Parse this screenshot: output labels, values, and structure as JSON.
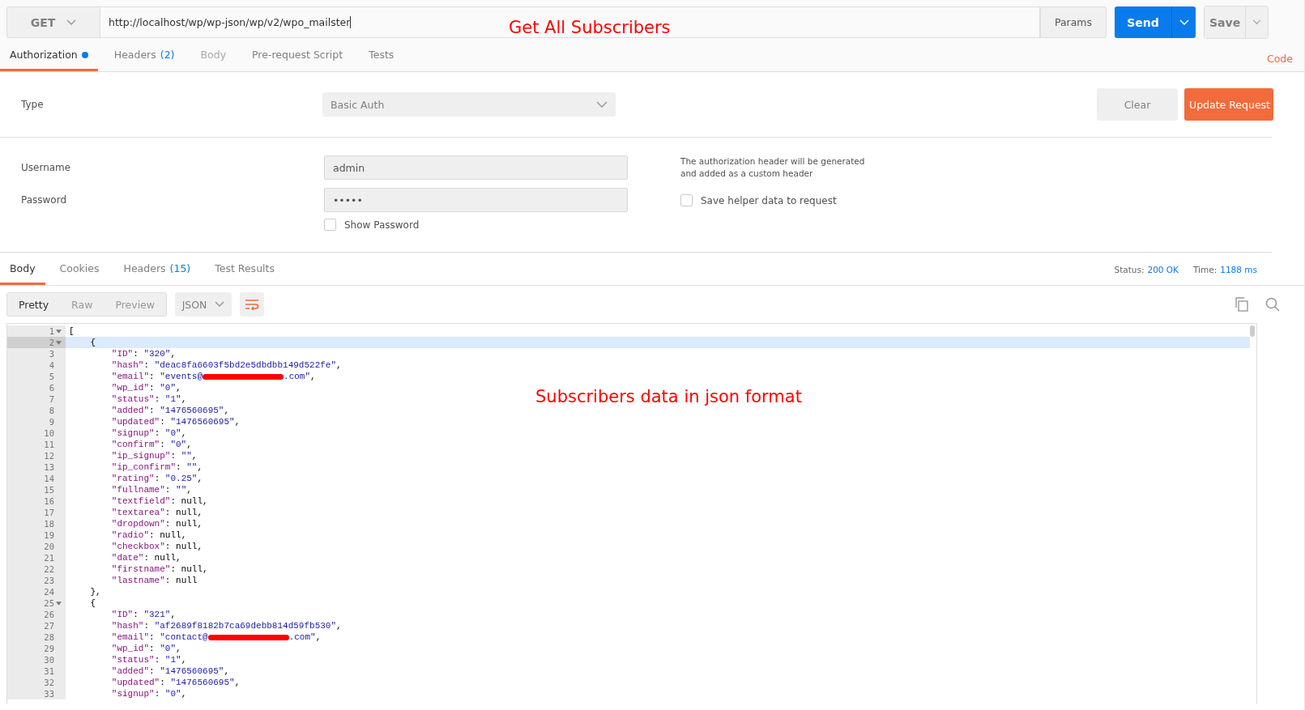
{
  "request": {
    "method": "GET",
    "url": "http://localhost/wp/wp-json/wp/v2/wpo_mailster",
    "params_label": "Params",
    "send_label": "Send",
    "save_label": "Save"
  },
  "request_tabs": [
    {
      "label": "Authorization",
      "selected": true,
      "dot": true,
      "disabled": false
    },
    {
      "label": "Headers",
      "count": "(2)",
      "selected": false,
      "dot": false,
      "disabled": false
    },
    {
      "label": "Body",
      "selected": false,
      "dot": false,
      "disabled": true
    },
    {
      "label": "Pre-request Script",
      "selected": false,
      "dot": false,
      "disabled": false
    },
    {
      "label": "Tests",
      "selected": false,
      "dot": false,
      "disabled": false
    }
  ],
  "code_link": "Code",
  "auth": {
    "type_label": "Type",
    "type_value": "Basic Auth",
    "clear_label": "Clear",
    "update_label": "Update Request",
    "username_label": "Username",
    "username": "admin",
    "password_label": "Password",
    "password": "•••••",
    "show_password": {
      "label": "Show Password",
      "checked": false
    },
    "note": "The authorization header will be generated and added as a custom header",
    "save_helper": {
      "label": "Save helper data to request",
      "checked": false
    }
  },
  "response_tabs": [
    {
      "label": "Body",
      "selected": true
    },
    {
      "label": "Cookies",
      "selected": false
    },
    {
      "label": "Headers",
      "count": "(15)",
      "selected": false
    },
    {
      "label": "Test Results",
      "selected": false
    }
  ],
  "status": {
    "status_label": "Status:",
    "status_value": "200 OK",
    "time_label": "Time:",
    "time_value": "1188 ms"
  },
  "view_modes": [
    {
      "label": "Pretty",
      "selected": true
    },
    {
      "label": "Raw",
      "selected": false
    },
    {
      "label": "Preview",
      "selected": false
    }
  ],
  "format": "JSON",
  "code_lines": [
    {
      "num": "1",
      "fold": true,
      "selected": false,
      "tokens": [
        {
          "kind": "plain",
          "text": "["
        }
      ]
    },
    {
      "num": "2",
      "fold": true,
      "selected": true,
      "tokens": [
        {
          "kind": "plain",
          "text": "    {"
        }
      ]
    },
    {
      "num": "3",
      "fold": false,
      "selected": false,
      "tokens": [
        {
          "kind": "key",
          "text": "        \"ID\""
        },
        {
          "kind": "plain",
          "text": ": "
        },
        {
          "kind": "str",
          "text": "\"320\""
        },
        {
          "kind": "plain",
          "text": ","
        }
      ]
    },
    {
      "num": "4",
      "fold": false,
      "selected": false,
      "tokens": [
        {
          "kind": "key",
          "text": "        \"hash\""
        },
        {
          "kind": "plain",
          "text": ": "
        },
        {
          "kind": "str",
          "text": "\"deac8fa6603f5bd2e5dbdbb149d522fe\""
        },
        {
          "kind": "plain",
          "text": ","
        }
      ]
    },
    {
      "num": "5",
      "fold": false,
      "selected": false,
      "tokens": [
        {
          "kind": "key",
          "text": "        \"email\""
        },
        {
          "kind": "plain",
          "text": ": "
        },
        {
          "kind": "str",
          "text": "\"events@"
        },
        {
          "kind": "redaction"
        },
        {
          "kind": "str",
          "text": ".com\""
        },
        {
          "kind": "plain",
          "text": ","
        }
      ]
    },
    {
      "num": "6",
      "fold": false,
      "selected": false,
      "tokens": [
        {
          "kind": "key",
          "text": "        \"wp_id\""
        },
        {
          "kind": "plain",
          "text": ": "
        },
        {
          "kind": "str",
          "text": "\"0\""
        },
        {
          "kind": "plain",
          "text": ","
        }
      ]
    },
    {
      "num": "7",
      "fold": false,
      "selected": false,
      "tokens": [
        {
          "kind": "key",
          "text": "        \"status\""
        },
        {
          "kind": "plain",
          "text": ": "
        },
        {
          "kind": "str",
          "text": "\"1\""
        },
        {
          "kind": "plain",
          "text": ","
        }
      ]
    },
    {
      "num": "8",
      "fold": false,
      "selected": false,
      "tokens": [
        {
          "kind": "key",
          "text": "        \"added\""
        },
        {
          "kind": "plain",
          "text": ": "
        },
        {
          "kind": "str",
          "text": "\"1476560695\""
        },
        {
          "kind": "plain",
          "text": ","
        }
      ]
    },
    {
      "num": "9",
      "fold": false,
      "selected": false,
      "tokens": [
        {
          "kind": "key",
          "text": "        \"updated\""
        },
        {
          "kind": "plain",
          "text": ": "
        },
        {
          "kind": "str",
          "text": "\"1476560695\""
        },
        {
          "kind": "plain",
          "text": ","
        }
      ]
    },
    {
      "num": "10",
      "fold": false,
      "selected": false,
      "tokens": [
        {
          "kind": "key",
          "text": "        \"signup\""
        },
        {
          "kind": "plain",
          "text": ": "
        },
        {
          "kind": "str",
          "text": "\"0\""
        },
        {
          "kind": "plain",
          "text": ","
        }
      ]
    },
    {
      "num": "11",
      "fold": false,
      "selected": false,
      "tokens": [
        {
          "kind": "key",
          "text": "        \"confirm\""
        },
        {
          "kind": "plain",
          "text": ": "
        },
        {
          "kind": "str",
          "text": "\"0\""
        },
        {
          "kind": "plain",
          "text": ","
        }
      ]
    },
    {
      "num": "12",
      "fold": false,
      "selected": false,
      "tokens": [
        {
          "kind": "key",
          "text": "        \"ip_signup\""
        },
        {
          "kind": "plain",
          "text": ": "
        },
        {
          "kind": "str",
          "text": "\"\""
        },
        {
          "kind": "plain",
          "text": ","
        }
      ]
    },
    {
      "num": "13",
      "fold": false,
      "selected": false,
      "tokens": [
        {
          "kind": "key",
          "text": "        \"ip_confirm\""
        },
        {
          "kind": "plain",
          "text": ": "
        },
        {
          "kind": "str",
          "text": "\"\""
        },
        {
          "kind": "plain",
          "text": ","
        }
      ]
    },
    {
      "num": "14",
      "fold": false,
      "selected": false,
      "tokens": [
        {
          "kind": "key",
          "text": "        \"rating\""
        },
        {
          "kind": "plain",
          "text": ": "
        },
        {
          "kind": "str",
          "text": "\"0.25\""
        },
        {
          "kind": "plain",
          "text": ","
        }
      ]
    },
    {
      "num": "15",
      "fold": false,
      "selected": false,
      "tokens": [
        {
          "kind": "key",
          "text": "        \"fullname\""
        },
        {
          "kind": "plain",
          "text": ": "
        },
        {
          "kind": "str",
          "text": "\"\""
        },
        {
          "kind": "plain",
          "text": ","
        }
      ]
    },
    {
      "num": "16",
      "fold": false,
      "selected": false,
      "tokens": [
        {
          "kind": "key",
          "text": "        \"textfield\""
        },
        {
          "kind": "plain",
          "text": ": null,"
        }
      ]
    },
    {
      "num": "17",
      "fold": false,
      "selected": false,
      "tokens": [
        {
          "kind": "key",
          "text": "        \"textarea\""
        },
        {
          "kind": "plain",
          "text": ": null,"
        }
      ]
    },
    {
      "num": "18",
      "fold": false,
      "selected": false,
      "tokens": [
        {
          "kind": "key",
          "text": "        \"dropdown\""
        },
        {
          "kind": "plain",
          "text": ": null,"
        }
      ]
    },
    {
      "num": "19",
      "fold": false,
      "selected": false,
      "tokens": [
        {
          "kind": "key",
          "text": "        \"radio\""
        },
        {
          "kind": "plain",
          "text": ": null,"
        }
      ]
    },
    {
      "num": "20",
      "fold": false,
      "selected": false,
      "tokens": [
        {
          "kind": "key",
          "text": "        \"checkbox\""
        },
        {
          "kind": "plain",
          "text": ": null,"
        }
      ]
    },
    {
      "num": "21",
      "fold": false,
      "selected": false,
      "tokens": [
        {
          "kind": "key",
          "text": "        \"date\""
        },
        {
          "kind": "plain",
          "text": ": null,"
        }
      ]
    },
    {
      "num": "22",
      "fold": false,
      "selected": false,
      "tokens": [
        {
          "kind": "key",
          "text": "        \"firstname\""
        },
        {
          "kind": "plain",
          "text": ": null,"
        }
      ]
    },
    {
      "num": "23",
      "fold": false,
      "selected": false,
      "tokens": [
        {
          "kind": "key",
          "text": "        \"lastname\""
        },
        {
          "kind": "plain",
          "text": ": null"
        }
      ]
    },
    {
      "num": "24",
      "fold": false,
      "selected": false,
      "tokens": [
        {
          "kind": "plain",
          "text": "    },"
        }
      ]
    },
    {
      "num": "25",
      "fold": true,
      "selected": false,
      "tokens": [
        {
          "kind": "plain",
          "text": "    {"
        }
      ]
    },
    {
      "num": "26",
      "fold": false,
      "selected": false,
      "tokens": [
        {
          "kind": "key",
          "text": "        \"ID\""
        },
        {
          "kind": "plain",
          "text": ": "
        },
        {
          "kind": "str",
          "text": "\"321\""
        },
        {
          "kind": "plain",
          "text": ","
        }
      ]
    },
    {
      "num": "27",
      "fold": false,
      "selected": false,
      "tokens": [
        {
          "kind": "key",
          "text": "        \"hash\""
        },
        {
          "kind": "plain",
          "text": ": "
        },
        {
          "kind": "str",
          "text": "\"af2689f8182b7ca69debb814d59fb530\""
        },
        {
          "kind": "plain",
          "text": ","
        }
      ]
    },
    {
      "num": "28",
      "fold": false,
      "selected": false,
      "tokens": [
        {
          "kind": "key",
          "text": "        \"email\""
        },
        {
          "kind": "plain",
          "text": ": "
        },
        {
          "kind": "str",
          "text": "\"contact@"
        },
        {
          "kind": "redaction"
        },
        {
          "kind": "str",
          "text": ".com\""
        },
        {
          "kind": "plain",
          "text": ","
        }
      ]
    },
    {
      "num": "29",
      "fold": false,
      "selected": false,
      "tokens": [
        {
          "kind": "key",
          "text": "        \"wp_id\""
        },
        {
          "kind": "plain",
          "text": ": "
        },
        {
          "kind": "str",
          "text": "\"0\""
        },
        {
          "kind": "plain",
          "text": ","
        }
      ]
    },
    {
      "num": "30",
      "fold": false,
      "selected": false,
      "tokens": [
        {
          "kind": "key",
          "text": "        \"status\""
        },
        {
          "kind": "plain",
          "text": ": "
        },
        {
          "kind": "str",
          "text": "\"1\""
        },
        {
          "kind": "plain",
          "text": ","
        }
      ]
    },
    {
      "num": "31",
      "fold": false,
      "selected": false,
      "tokens": [
        {
          "kind": "key",
          "text": "        \"added\""
        },
        {
          "kind": "plain",
          "text": ": "
        },
        {
          "kind": "str",
          "text": "\"1476560695\""
        },
        {
          "kind": "plain",
          "text": ","
        }
      ]
    },
    {
      "num": "32",
      "fold": false,
      "selected": false,
      "tokens": [
        {
          "kind": "key",
          "text": "        \"updated\""
        },
        {
          "kind": "plain",
          "text": ": "
        },
        {
          "kind": "str",
          "text": "\"1476560695\""
        },
        {
          "kind": "plain",
          "text": ","
        }
      ]
    },
    {
      "num": "33",
      "fold": false,
      "selected": false,
      "tokens": [
        {
          "kind": "key",
          "text": "        \"signup\""
        },
        {
          "kind": "plain",
          "text": ": "
        },
        {
          "kind": "str",
          "text": "\"0\""
        },
        {
          "kind": "plain",
          "text": ","
        }
      ]
    }
  ],
  "annotations": [
    "Get All Subscribers",
    "Subscribers data in json format"
  ]
}
